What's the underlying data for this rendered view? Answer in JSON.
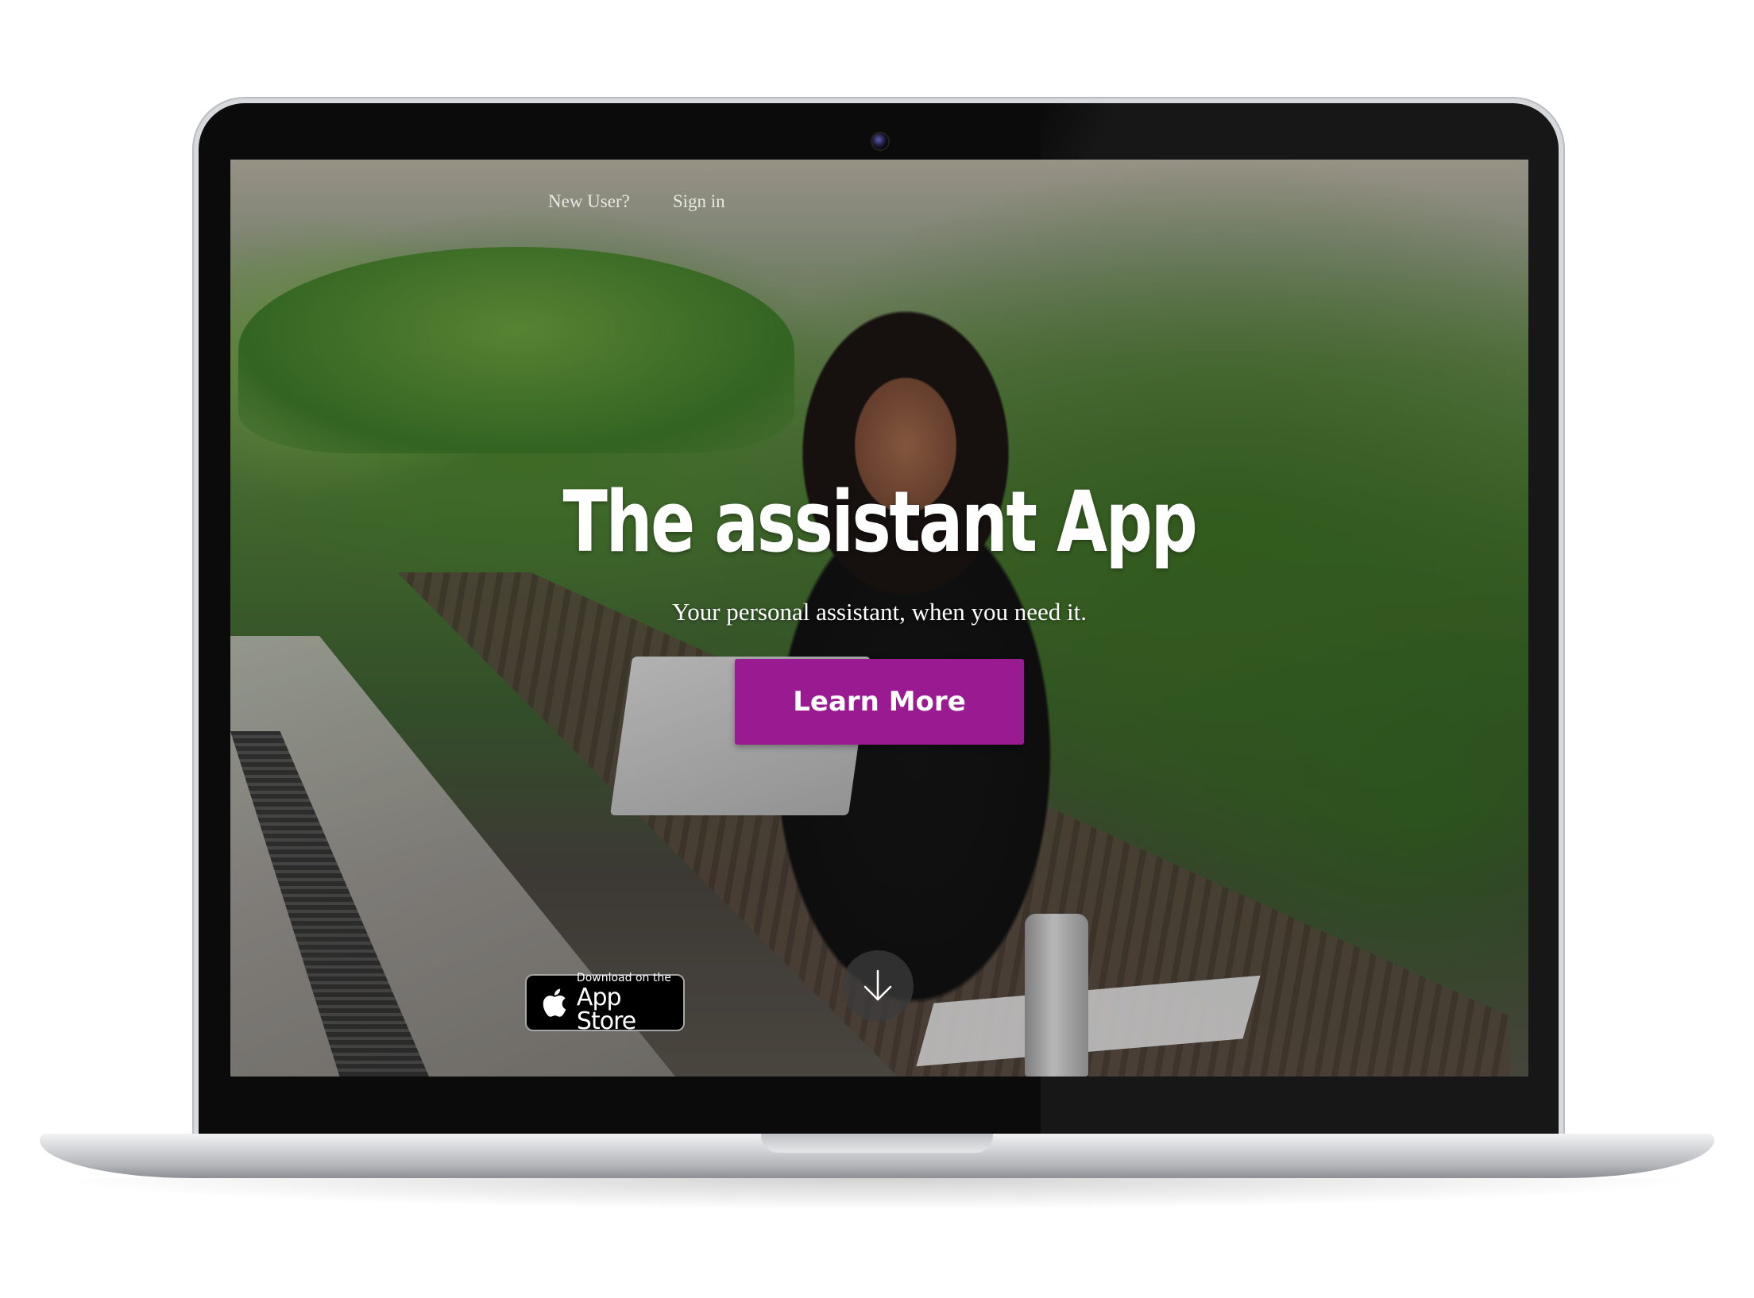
{
  "nav": {
    "new_user": "New User?",
    "sign_in": "Sign in"
  },
  "hero": {
    "title": "The assistant App",
    "subtitle": "Your personal assistant, when you need it.",
    "cta_label": "Learn More"
  },
  "app_store": {
    "small_text": "Download on the",
    "big_text": "App Store",
    "icon": "apple-icon"
  },
  "scroll": {
    "icon": "arrow-down-icon"
  },
  "colors": {
    "cta": "#9a1a91",
    "text": "#ffffff"
  }
}
